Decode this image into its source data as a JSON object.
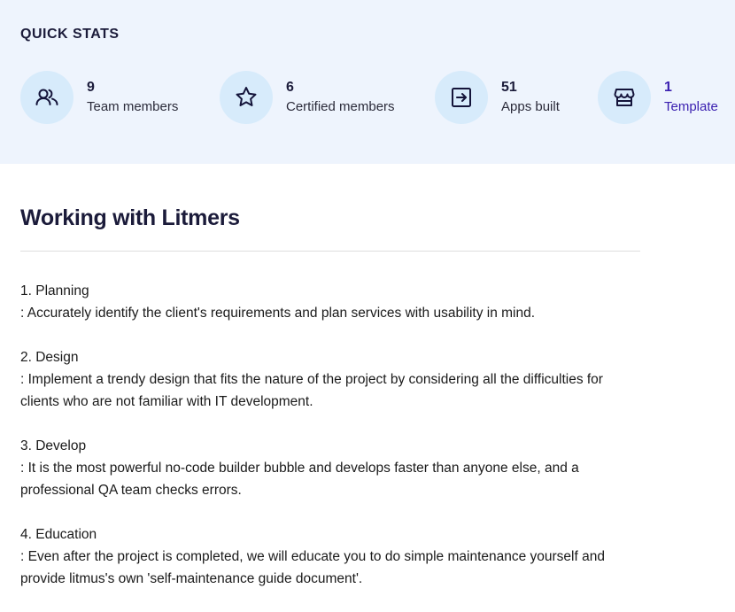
{
  "quick_stats": {
    "title": "QUICK STATS",
    "items": [
      {
        "value": "9",
        "label": "Team members",
        "icon": "users-icon"
      },
      {
        "value": "6",
        "label": "Certified members",
        "icon": "star-icon"
      },
      {
        "value": "51",
        "label": "Apps built",
        "icon": "arrow-into-box-icon"
      },
      {
        "value": "1",
        "label": "Template",
        "icon": "store-icon"
      }
    ]
  },
  "working": {
    "title": "Working with Litmers",
    "steps": [
      {
        "heading": "1. Planning",
        "body": ": Accurately identify the client's requirements and plan services with usability in mind."
      },
      {
        "heading": "2. Design",
        "body": ": Implement a trendy design that fits the nature of the project by considering all the difficulties for clients who are not familiar with IT development."
      },
      {
        "heading": "3. Develop",
        "body": ": It is the most powerful no-code builder bubble and develops faster than anyone else, and a professional QA team checks errors."
      },
      {
        "heading": "4. Education",
        "body": ": Even after the project is completed, we will educate you to do simple maintenance yourself and provide litmus's own 'self-maintenance guide document'."
      }
    ]
  },
  "colors": {
    "panel_bg": "#eef4fd",
    "icon_circle": "#d7ebfb",
    "heading": "#1b1b3a",
    "link": "#3a1fb0"
  }
}
